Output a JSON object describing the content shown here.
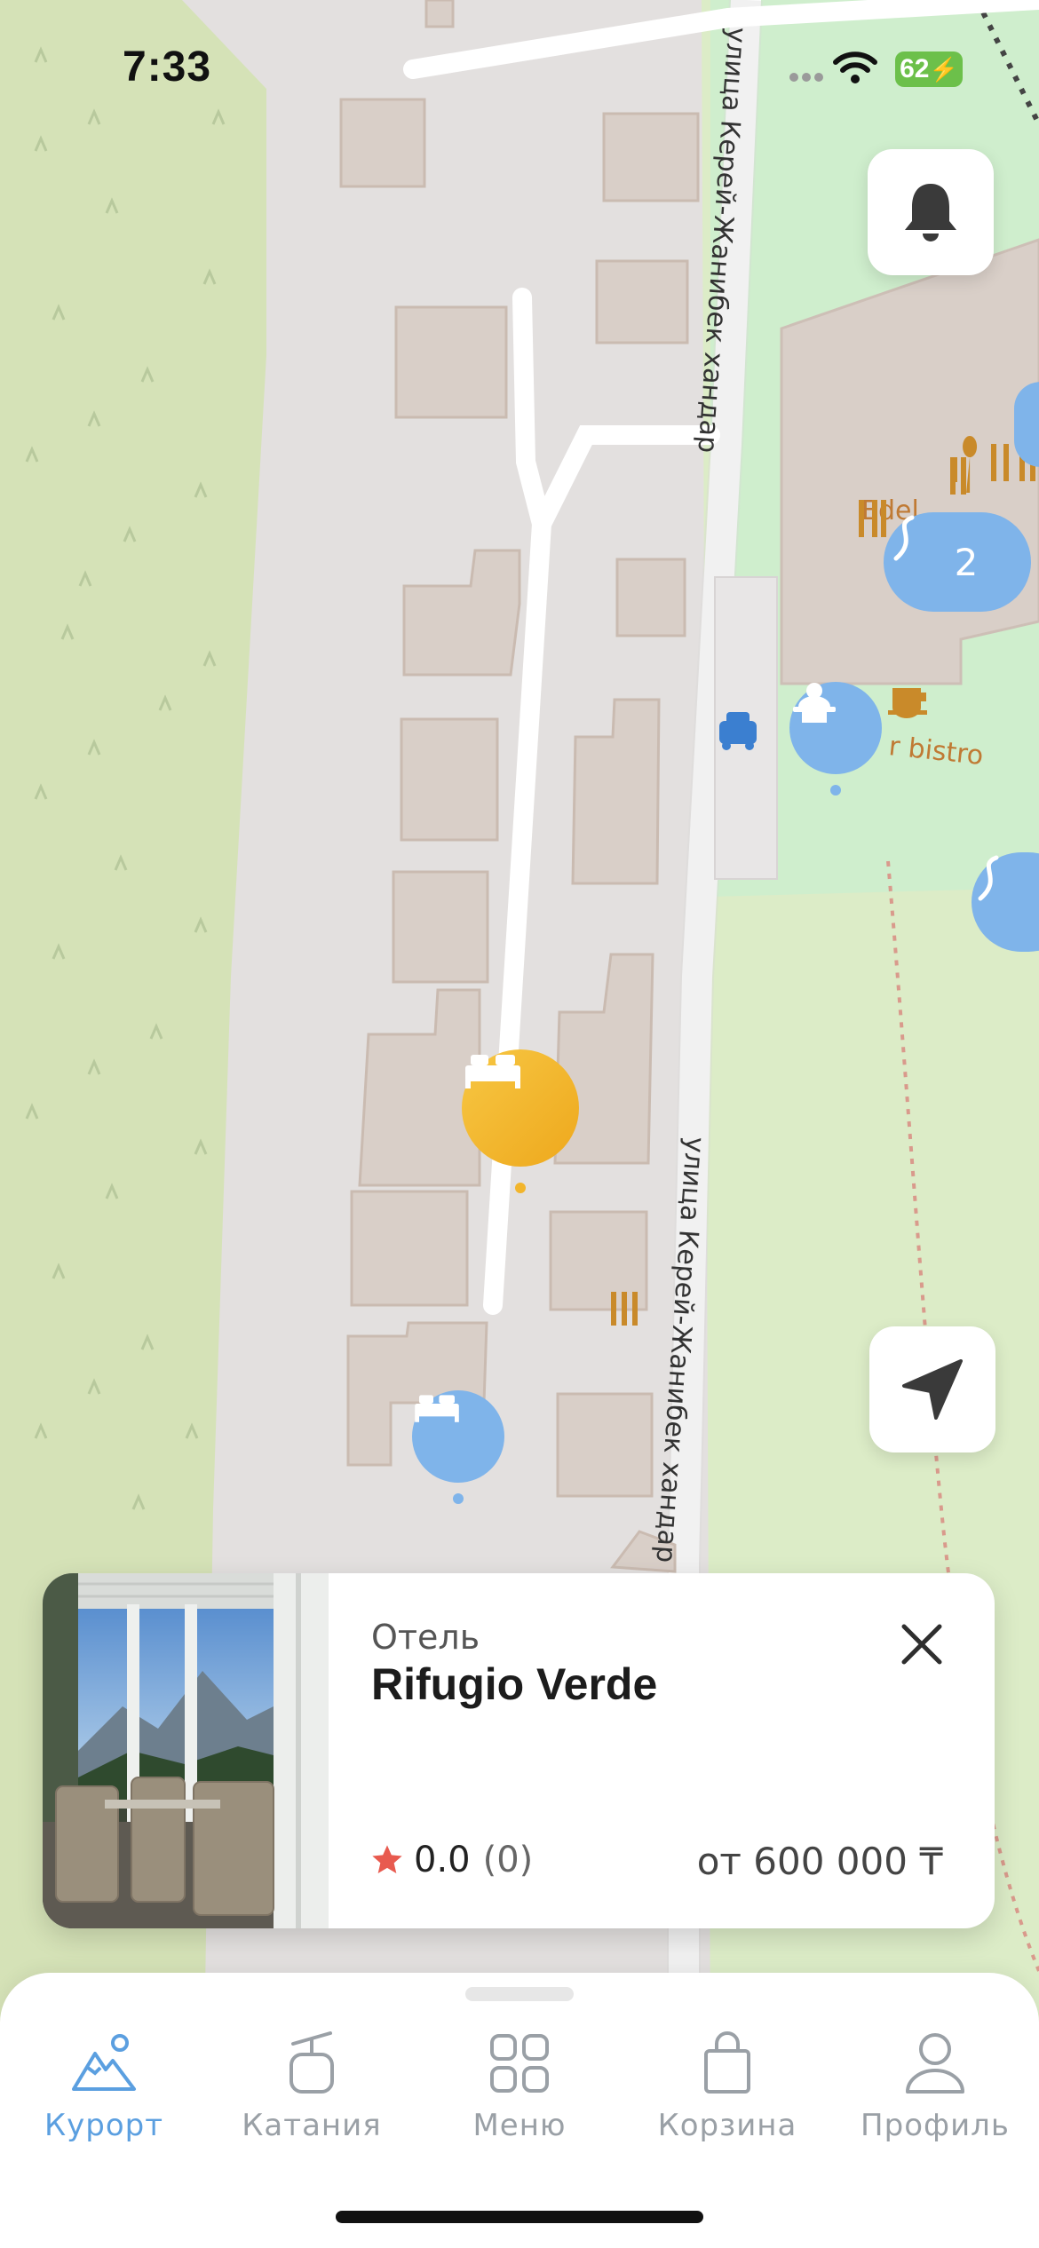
{
  "status_bar": {
    "time": "7:33",
    "battery": "62"
  },
  "map": {
    "street_label_top": "улица Керей-Жанибек хандар",
    "street_label_bottom": "улица Керей-Жанибек хандар",
    "poi_label_1": "Edel",
    "poi_label_2": "r bistro",
    "cluster_count": "2"
  },
  "buttons": {
    "notifications_icon": "bell-icon",
    "locate_icon": "navigation-arrow-icon"
  },
  "card": {
    "type_label": "Отель",
    "hotel_name": "Rifugio Verde",
    "rating": "0.0",
    "reviews": "(0)",
    "price": "от 600 000 ₸"
  },
  "tabs": [
    {
      "label": "Курорт",
      "icon": "mountain-icon",
      "active": true
    },
    {
      "label": "Катания",
      "icon": "cable-car-icon",
      "active": false
    },
    {
      "label": "Меню",
      "icon": "grid-icon",
      "active": false
    },
    {
      "label": "Корзина",
      "icon": "shopping-bag-icon",
      "active": false
    },
    {
      "label": "Профиль",
      "icon": "user-icon",
      "active": false
    }
  ],
  "colors": {
    "accent": "#5b9fe0",
    "marker_blue": "#7fb4ea",
    "marker_orange": "#f2b52c",
    "star": "#e85a4f",
    "map_green": "#d6e3b8",
    "map_grey": "#e3e0df",
    "building": "#d9cfc8"
  }
}
